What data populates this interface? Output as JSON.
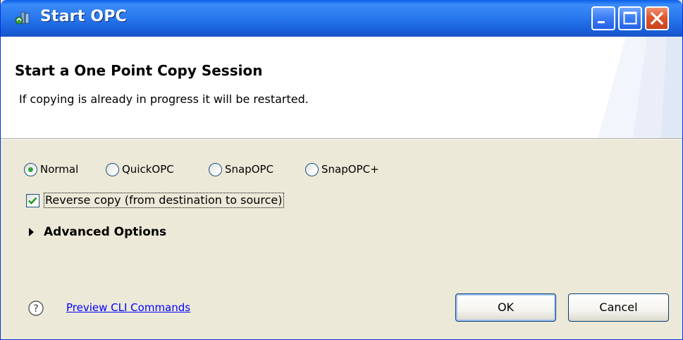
{
  "window": {
    "title": "Start OPC",
    "icon": "opc-app-icon",
    "controls": [
      "minimize-icon",
      "maximize-icon",
      "close-icon"
    ]
  },
  "header": {
    "title": "Start a One Point Copy Session",
    "message": "If copying is already in progress it will be restarted."
  },
  "mode": {
    "options": [
      "Normal",
      "QuickOPC",
      "SnapOPC",
      "SnapOPC+"
    ],
    "selected": "Normal"
  },
  "reverse_copy": {
    "label": "Reverse copy (from destination to source)",
    "checked": true
  },
  "advanced": {
    "label": "Advanced Options",
    "expanded": false
  },
  "footer": {
    "help_icon": "help-icon",
    "cli_link": "Preview CLI Commands",
    "ok_label": "OK",
    "cancel_label": "Cancel"
  },
  "colors": {
    "titlebar": "#2d7df0",
    "dialog_bg": "#ece9d8",
    "link": "#0000ff",
    "radio_dot": "#30a43e"
  }
}
